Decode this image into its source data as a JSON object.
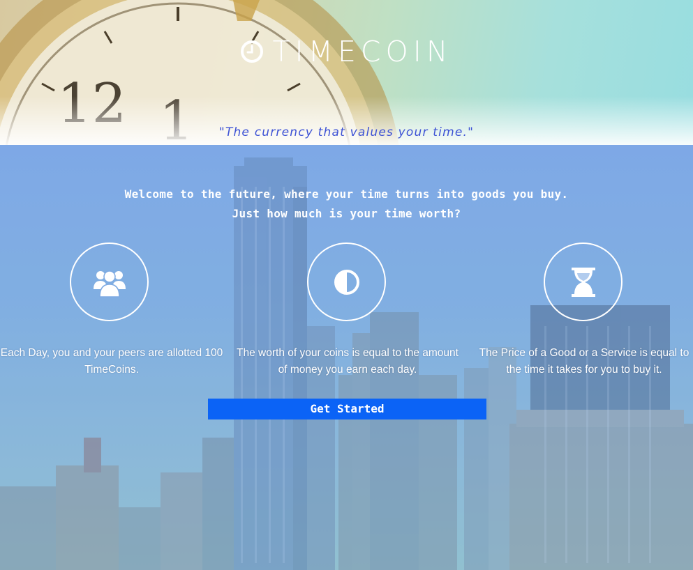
{
  "header": {
    "logo_text": "TIMECOIN",
    "tagline": "\"The currency that values your time.\"",
    "clock_numbers": [
      "12",
      "1"
    ]
  },
  "hero": {
    "welcome_line1": "Welcome to the future, where your time turns into goods you buy.",
    "welcome_line2": "Just how much is your time worth?"
  },
  "features": [
    {
      "icon": "users-icon",
      "text": "Each Day, you and your peers are allotted 100 TimeCoins."
    },
    {
      "icon": "half-circle-icon",
      "text": "The worth of your coins is equal to the amount of money you earn each day."
    },
    {
      "icon": "hourglass-icon",
      "text": "The Price of a Good or a Service is equal to the time it takes for you to buy it."
    }
  ],
  "cta": {
    "label": "Get Started"
  },
  "colors": {
    "tagline": "#3d52d5",
    "button": "#0b63f6",
    "text": "#ffffff"
  }
}
